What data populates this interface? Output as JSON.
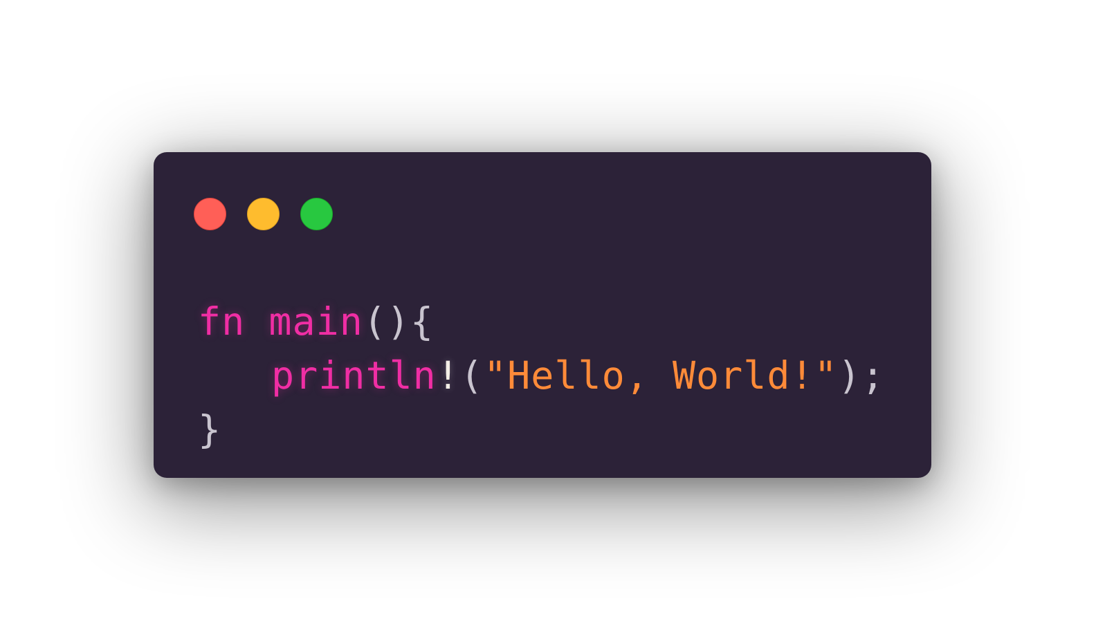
{
  "window": {
    "controls": {
      "close": "red-circle",
      "minimize": "yellow-circle",
      "maximize": "green-circle"
    },
    "colors": {
      "background": "#2c2238",
      "keyword": "#f02ea4",
      "string": "#ff8b39",
      "punctuation": "#c9c4cf"
    }
  },
  "code": {
    "line1": {
      "keyword": "fn",
      "function_name": "main",
      "parens": "()",
      "open_brace": "{"
    },
    "line2": {
      "macro": "println",
      "bang": "!",
      "open_paren": "(",
      "string": "\"Hello, World!\"",
      "close": ");"
    },
    "line3": {
      "close_brace": "}"
    }
  }
}
